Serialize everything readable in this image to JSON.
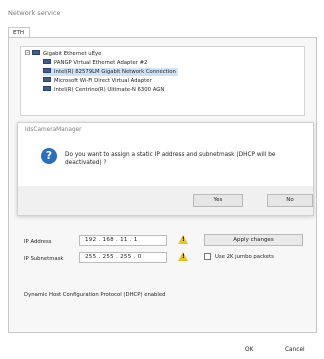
{
  "window": {
    "title": "Network service"
  },
  "tabs": [
    {
      "label": "ETH"
    }
  ],
  "tree": {
    "root": {
      "label": "Gigabit Ethernet uEye"
    },
    "children": [
      {
        "label": "PANGP Virtual Ethernet Adapter #2"
      },
      {
        "label": "Intel(R) 82579LM Gigabit Network Connection"
      },
      {
        "label": "Microsoft Wi-Fi Direct Virtual Adapter"
      },
      {
        "label": "Intel(R) Centrino(R) Ultimate-N 6300 AGN"
      }
    ]
  },
  "form": {
    "ip_label": "IP Address",
    "ip_octets": [
      "192",
      "168",
      "11",
      "1"
    ],
    "subnet_label": "IP Subnetmask",
    "subnet_octets": [
      "255",
      "255",
      "255",
      "0"
    ],
    "apply_label": "Apply changes",
    "jumbo_label": "Use 2K jumbo packets",
    "dhcp_status": "Dynamic Host Configuration Protocol (DHCP) enabled"
  },
  "dialog": {
    "title": "IdsCameraManager",
    "message": "Do you want to assign a static IP address and subnetmask (DHCP will be deactivated) ?",
    "yes_label": "Yes",
    "no_label": "No"
  },
  "footer": {
    "ok_label": "OK",
    "cancel_label": "Cancel"
  },
  "colors": {
    "accent": "#2a6ebd",
    "warning": "#e8c51d",
    "selection": "#cfe2f7"
  },
  "icons": [
    "network-adapter-icon",
    "question-icon",
    "warning-icon"
  ]
}
